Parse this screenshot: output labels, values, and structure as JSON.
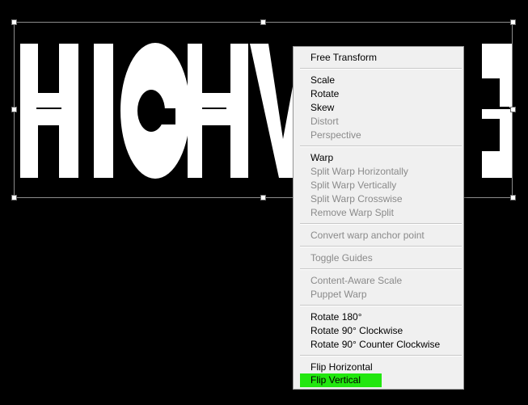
{
  "artwork": {
    "text": "HIGHWAVE",
    "fill_color": "#ffffff",
    "background_color": "#000000"
  },
  "context_menu": {
    "items": [
      {
        "label": "Free Transform",
        "enabled": true
      },
      {
        "label": "Scale",
        "enabled": true
      },
      {
        "label": "Rotate",
        "enabled": true
      },
      {
        "label": "Skew",
        "enabled": true
      },
      {
        "label": "Distort",
        "enabled": false
      },
      {
        "label": "Perspective",
        "enabled": false
      },
      {
        "label": "Warp",
        "enabled": true
      },
      {
        "label": "Split Warp Horizontally",
        "enabled": false
      },
      {
        "label": "Split Warp Vertically",
        "enabled": false
      },
      {
        "label": "Split Warp Crosswise",
        "enabled": false
      },
      {
        "label": "Remove Warp Split",
        "enabled": false
      },
      {
        "label": "Convert warp anchor point",
        "enabled": false
      },
      {
        "label": "Toggle Guides",
        "enabled": false
      },
      {
        "label": "Content-Aware Scale",
        "enabled": false
      },
      {
        "label": "Puppet Warp",
        "enabled": false
      },
      {
        "label": "Rotate 180°",
        "enabled": true
      },
      {
        "label": "Rotate 90° Clockwise",
        "enabled": true
      },
      {
        "label": "Rotate 90° Counter Clockwise",
        "enabled": true
      },
      {
        "label": "Flip Horizontal",
        "enabled": true
      },
      {
        "label": "Flip Vertical",
        "enabled": true,
        "highlighted": true
      }
    ],
    "highlight_color": "#22e70f"
  }
}
